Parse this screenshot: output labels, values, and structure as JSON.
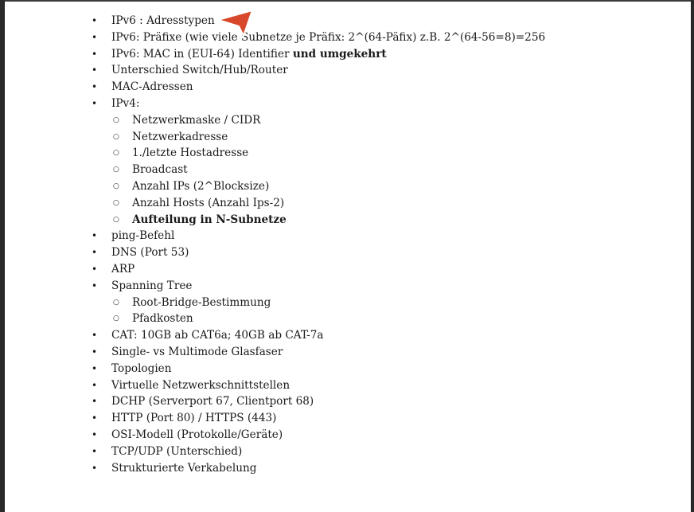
{
  "items": [
    {
      "text": "IPv6 : Adresstypen"
    },
    {
      "text": "IPv6: Präfixe (wie viele Subnetze je Präfix: 2^(64-Päfix) z.B. 2^(64-56=8)=256"
    },
    {
      "text": "IPv6: MAC in (EUI-64) Identifier ",
      "bold_text": "und umgekehrt"
    },
    {
      "text": "Unterschied Switch/Hub/Router"
    },
    {
      "text": "MAC-Adressen"
    },
    {
      "text": "IPv4:"
    },
    {
      "text": "ping-Befehl"
    },
    {
      "text": "DNS (Port 53)"
    },
    {
      "text": "ARP"
    },
    {
      "text": "Spanning Tree"
    },
    {
      "text": "CAT: 10GB ab CAT6a; 40GB ab CAT-7a"
    },
    {
      "text": "Single- vs Multimode Glasfaser"
    },
    {
      "text": "Topologien"
    },
    {
      "text": "Virtuelle Netzwerkschnittstellen"
    },
    {
      "text": "DCHP (Serverport 67, Clientport 68)"
    },
    {
      "text": "HTTP (Port 80) / HTTPS (443)"
    },
    {
      "text": "OSI-Modell (Protokolle/Geräte)"
    },
    {
      "text": "TCP/UDP (Unterschied)"
    },
    {
      "text": "Strukturierte Verkabelung"
    }
  ],
  "ipv4_sub": [
    {
      "text": "Netzwerkmaske / CIDR"
    },
    {
      "text": "Netzwerkadresse"
    },
    {
      "text": "1./letzte Hostadresse"
    },
    {
      "text": "Broadcast"
    },
    {
      "text": "Anzahl IPs (2^Blocksize)"
    },
    {
      "text": "Anzahl Hosts (Anzahl Ips-2)"
    },
    {
      "text": "Aufteilung in N-Subnetze",
      "bold": true
    }
  ],
  "spanning_sub": [
    {
      "text": "Root-Bridge-Bestimmung"
    },
    {
      "text": "Pfadkosten"
    }
  ],
  "cursor": {
    "icon": "pointer-arrow-icon",
    "color": "#d9472b"
  }
}
